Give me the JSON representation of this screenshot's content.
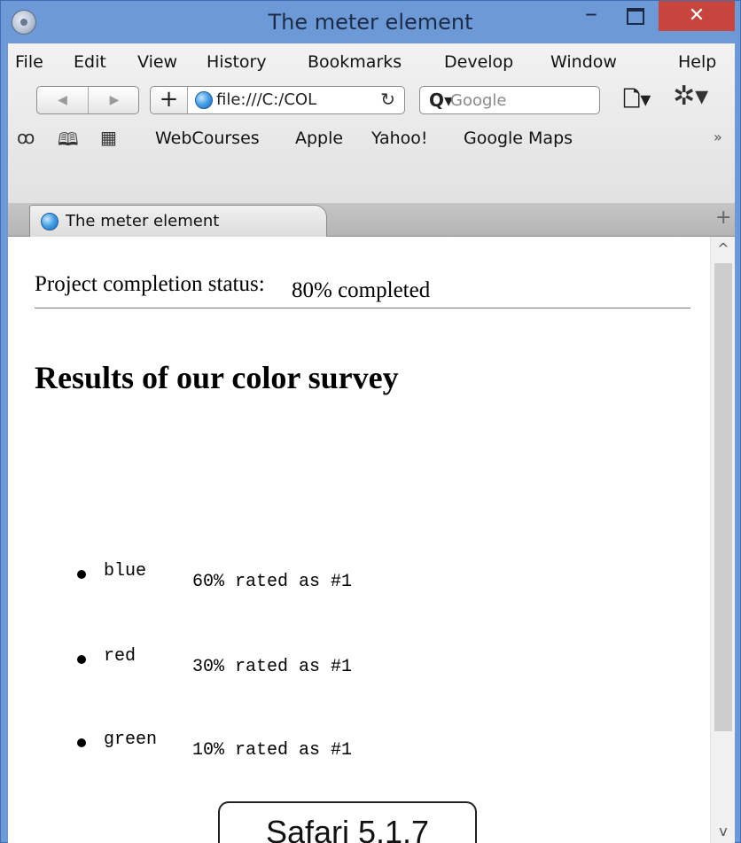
{
  "window": {
    "title": "The meter element",
    "minimize_glyph": "–",
    "close_glyph": "✕"
  },
  "menubar": {
    "items": [
      "File",
      "Edit",
      "View",
      "History",
      "Bookmarks",
      "Develop",
      "Window",
      "Help"
    ]
  },
  "toolbar": {
    "back_glyph": "◀",
    "forward_glyph": "▶",
    "plus_glyph": "+",
    "address": "file:///C:/COL",
    "reload_glyph": "↻",
    "search_glyph": "Q▾",
    "search_placeholder": "Google",
    "page_menu_glyph": "🗋▾",
    "gear_glyph": "✲▾"
  },
  "bookmarks": {
    "icons": [
      "reading-list-icon",
      "book-icon",
      "grid-icon"
    ],
    "reading_glyph": "ꝏ",
    "book_glyph": "🕮",
    "grid_glyph": "▦",
    "items": [
      "WebCourses",
      "Apple",
      "Yahoo!",
      "Google Maps"
    ],
    "more_glyph": "»"
  },
  "tabs": {
    "active": "The meter element",
    "new_tab_glyph": "+"
  },
  "page": {
    "status_label": "Project completion status:",
    "meter_text": "80% completed",
    "heading": "Results of our color survey",
    "survey": [
      {
        "color": "blue",
        "rating": "60% rated as #1"
      },
      {
        "color": "red",
        "rating": "30% rated as #1"
      },
      {
        "color": "green",
        "rating": "10% rated as #1"
      }
    ]
  },
  "scrollbar": {
    "up_glyph": "^",
    "down_glyph": "v"
  },
  "callout": {
    "text": "Safari 5.1.7"
  },
  "colors": {
    "titlebar": "#6d9ad7",
    "close_button": "#c7453c",
    "content_bg": "#ffffff"
  }
}
